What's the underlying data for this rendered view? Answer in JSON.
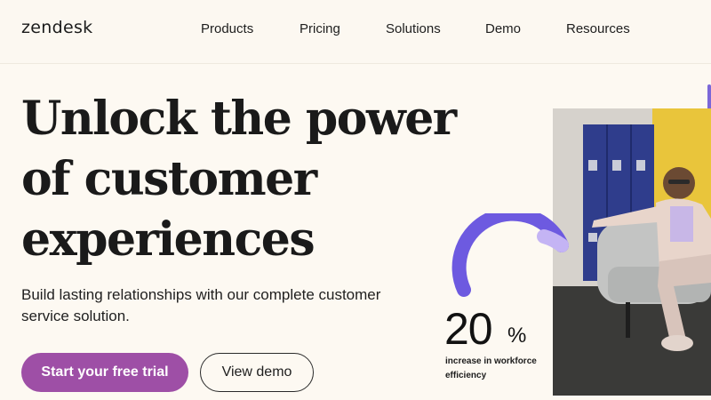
{
  "nav": {
    "logo": "zendesk",
    "items": [
      {
        "label": "Products"
      },
      {
        "label": "Pricing"
      },
      {
        "label": "Solutions"
      },
      {
        "label": "Demo"
      },
      {
        "label": "Resources"
      }
    ]
  },
  "hero": {
    "headline_lines": [
      "Unlock the power",
      "of customer",
      "experiences"
    ],
    "subtext": "Build lasting relationships with our complete customer service solution.",
    "primary_cta": "Start your free trial",
    "secondary_cta": "View demo"
  },
  "stat": {
    "value": "20",
    "unit": "%",
    "caption": "increase in workforce efficiency"
  },
  "colors": {
    "background": "#fdf9f2",
    "primary_button": "#9e4fa6",
    "accent_arc": "#6d5ae0",
    "text": "#1a1a1a"
  }
}
